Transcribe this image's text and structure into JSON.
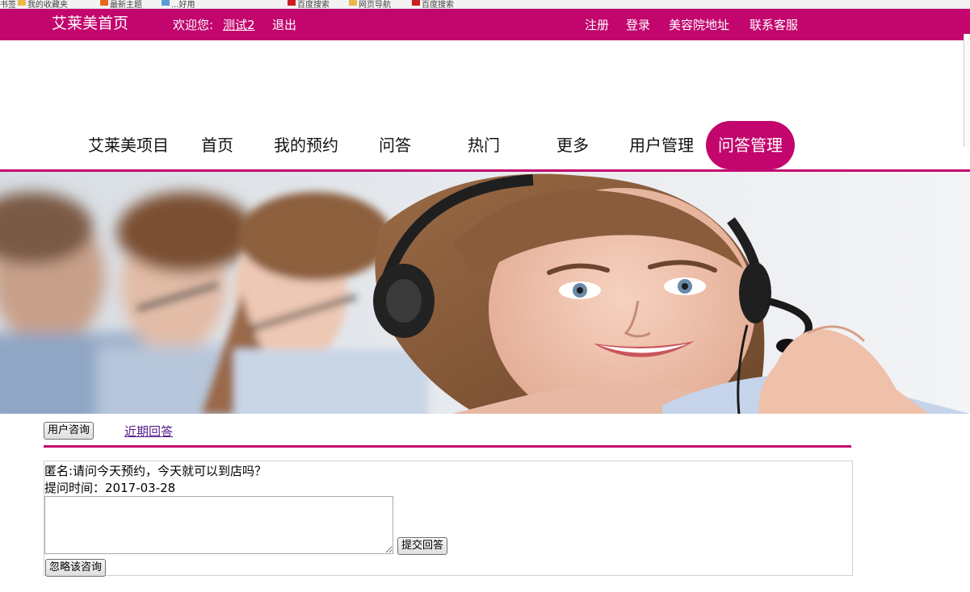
{
  "bookmarks": [
    {
      "label": "书签"
    },
    {
      "label": "我的收藏夹"
    },
    {
      "label": "最新主题"
    },
    {
      "label": "...好用"
    },
    {
      "label": "百度搜索"
    },
    {
      "label": "网页导航"
    },
    {
      "label": "百度搜索"
    }
  ],
  "topbar": {
    "site_home": "艾莱美首页",
    "welcome": "欢迎您:",
    "username": "测试2",
    "logout": "退出",
    "register": "注册",
    "login": "登录",
    "address": "美容院地址",
    "service": "联系客服"
  },
  "nav": {
    "items": [
      {
        "label": "艾莱美项目"
      },
      {
        "label": "首页"
      },
      {
        "label": "我的预约"
      },
      {
        "label": "问答"
      },
      {
        "label": "热门"
      },
      {
        "label": "更多"
      },
      {
        "label": "用户管理"
      },
      {
        "label": "问答管理"
      }
    ],
    "active_index": 7
  },
  "qa": {
    "tab_consult": "用户咨询",
    "tab_recent": "近期回答",
    "question": {
      "text": "匿名:请问今天预约，今天就可以到店吗？",
      "time_label": "提问时间：",
      "time_value": "2017-03-28",
      "answer_value": "",
      "submit_label": "提交回答",
      "ignore_label": "忽略该咨询"
    }
  },
  "theme": {
    "accent": "#c2066e",
    "link_visited": "#551a8b"
  }
}
